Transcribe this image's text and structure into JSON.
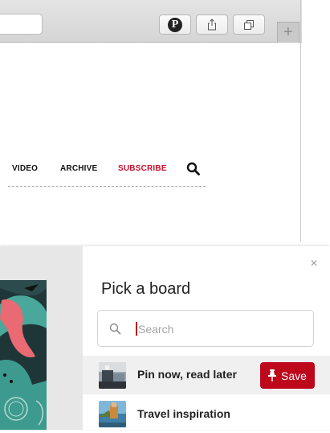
{
  "browser": {
    "new_tab_label": "+"
  },
  "site_nav": {
    "items": [
      {
        "label": "VIDEO"
      },
      {
        "label": "ARCHIVE"
      },
      {
        "label": "SUBSCRIBE",
        "color": "#c6102e"
      }
    ]
  },
  "dialog": {
    "close_label": "×",
    "title": "Pick a board",
    "search_placeholder": "Search",
    "boards": [
      {
        "name": "Pin now, read later",
        "highlighted": true,
        "save_label": "Save"
      },
      {
        "name": "Travel inspiration",
        "highlighted": false
      }
    ]
  },
  "colors": {
    "pinterest_red": "#bd081c",
    "subscribe_red": "#c6102e"
  },
  "icons": [
    "pinterest-icon",
    "share-icon",
    "tabs-icon",
    "plus-icon",
    "search-icon",
    "close-icon",
    "pin-icon"
  ]
}
